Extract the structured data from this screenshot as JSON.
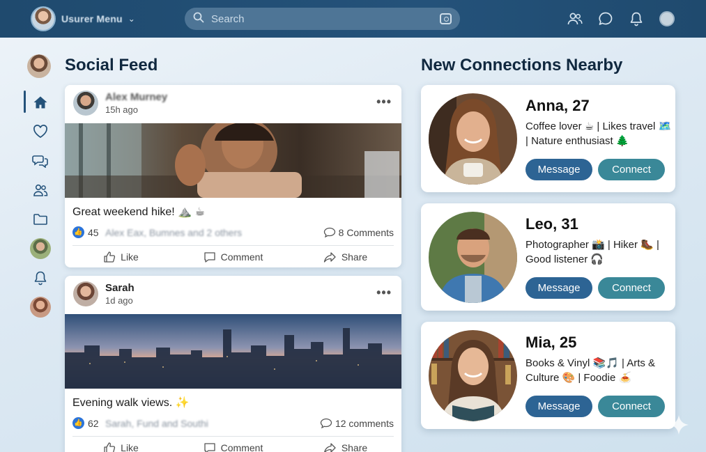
{
  "topbar": {
    "user_menu_label": "Usurer Menu",
    "search_placeholder": "Search",
    "icons": [
      "people-icon",
      "chat-icon",
      "bell-icon",
      "profile-dot"
    ]
  },
  "sidebar": {
    "items": [
      {
        "name": "home-icon",
        "active": true
      },
      {
        "name": "heart-icon"
      },
      {
        "name": "messages-icon"
      },
      {
        "name": "friends-icon"
      },
      {
        "name": "folder-icon"
      },
      {
        "name": "avatar"
      },
      {
        "name": "bell-icon"
      },
      {
        "name": "avatar"
      }
    ]
  },
  "feed": {
    "title": "Social Feed",
    "posts": [
      {
        "author": "Alex Murney",
        "time": "15h ago",
        "text": "Great weekend hike! ⛰️ ☕",
        "likes": "45",
        "likers": "Alex Eax, Bumnes and 2 others",
        "comments": "8 Comments",
        "like_label": "Like",
        "comment_label": "Comment",
        "share_label": "Share"
      },
      {
        "author": "Sarah",
        "time": "1d ago",
        "text": "Evening walk views. ✨",
        "likes": "62",
        "likers": "Sarah, Fund and Southi",
        "comments": "12 comments",
        "like_label": "Like",
        "comment_label": "Comment",
        "share_label": "Share"
      }
    ]
  },
  "connections": {
    "title": "New Connections Nearby",
    "people": [
      {
        "name": "Anna, 27",
        "bio": "Coffee lover ☕ | Likes travel 🗺️ | Nature enthusiast 🌲",
        "message": "Message",
        "connect": "Connect"
      },
      {
        "name": "Leo, 31",
        "bio": "Photographer 📸 | Hiker 🥾 | Good listener 🎧",
        "message": "Message",
        "connect": "Connect"
      },
      {
        "name": "Mia, 25",
        "bio": "Books & Vinyl 📚🎵 | Arts & Culture 🎨 | Foodie 🍝",
        "message": "Message",
        "connect": "Connect"
      }
    ]
  },
  "colors": {
    "topbar": "#24527a",
    "message_button": "#2d6494",
    "connect_button": "#3a8898",
    "like_badge": "#2c74d8"
  }
}
